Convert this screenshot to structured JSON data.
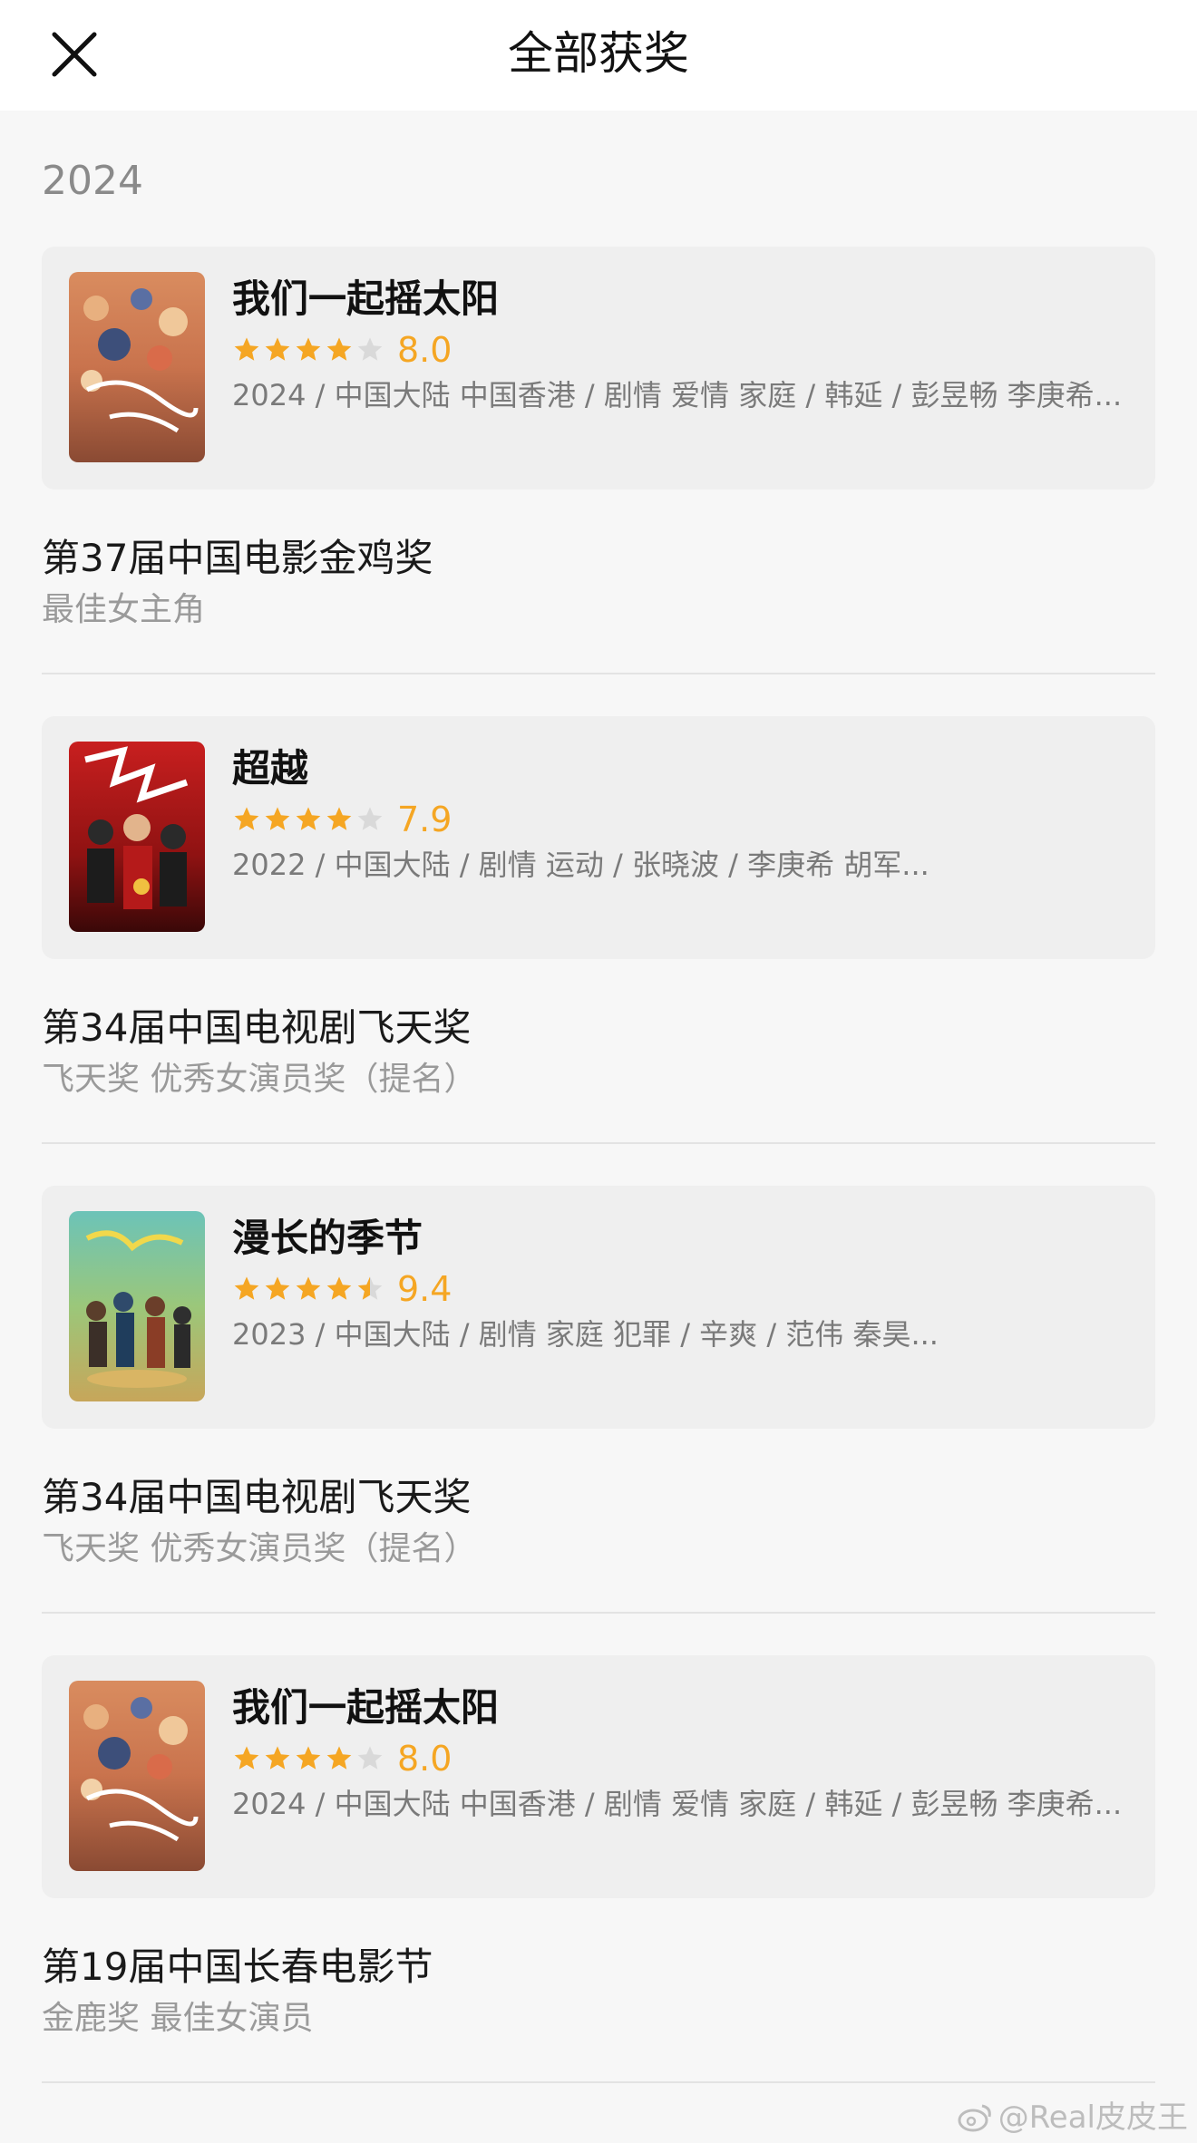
{
  "header": {
    "title": "全部获奖"
  },
  "year": "2024",
  "colors": {
    "star_filled": "#f5a623",
    "star_empty": "#d9d9d9",
    "rating_text": "#f5a623"
  },
  "entries": [
    {
      "movie": {
        "title": "我们一起摇太阳",
        "rating": "8.0",
        "stars": 4,
        "info": "2024 / 中国大陆 中国香港 / 剧情 爱情 家庭 / 韩延 / 彭昱畅 李庚希...",
        "poster_icon": "poster-image"
      },
      "award": {
        "name": "第37届中国电影金鸡奖",
        "detail": "最佳女主角"
      }
    },
    {
      "movie": {
        "title": "超越",
        "rating": "7.9",
        "stars": 4,
        "info": "2022 / 中国大陆 / 剧情 运动 / 张晓波 / 李庚希 胡军...",
        "poster_icon": "poster-image"
      },
      "award": {
        "name": "第34届中国电视剧飞天奖",
        "detail": "飞天奖 优秀女演员奖（提名）"
      }
    },
    {
      "movie": {
        "title": "漫长的季节",
        "rating": "9.4",
        "stars": 4.5,
        "info": "2023 / 中国大陆 / 剧情 家庭 犯罪 / 辛爽 / 范伟 秦昊...",
        "poster_icon": "poster-image"
      },
      "award": {
        "name": "第34届中国电视剧飞天奖",
        "detail": "飞天奖 优秀女演员奖（提名）"
      }
    },
    {
      "movie": {
        "title": "我们一起摇太阳",
        "rating": "8.0",
        "stars": 4,
        "info": "2024 / 中国大陆 中国香港 / 剧情 爱情 家庭 / 韩延 / 彭昱畅 李庚希...",
        "poster_icon": "poster-image"
      },
      "award": {
        "name": "第19届中国长春电影节",
        "detail": "金鹿奖 最佳女演员"
      }
    }
  ],
  "watermark": "@Real皮皮王"
}
